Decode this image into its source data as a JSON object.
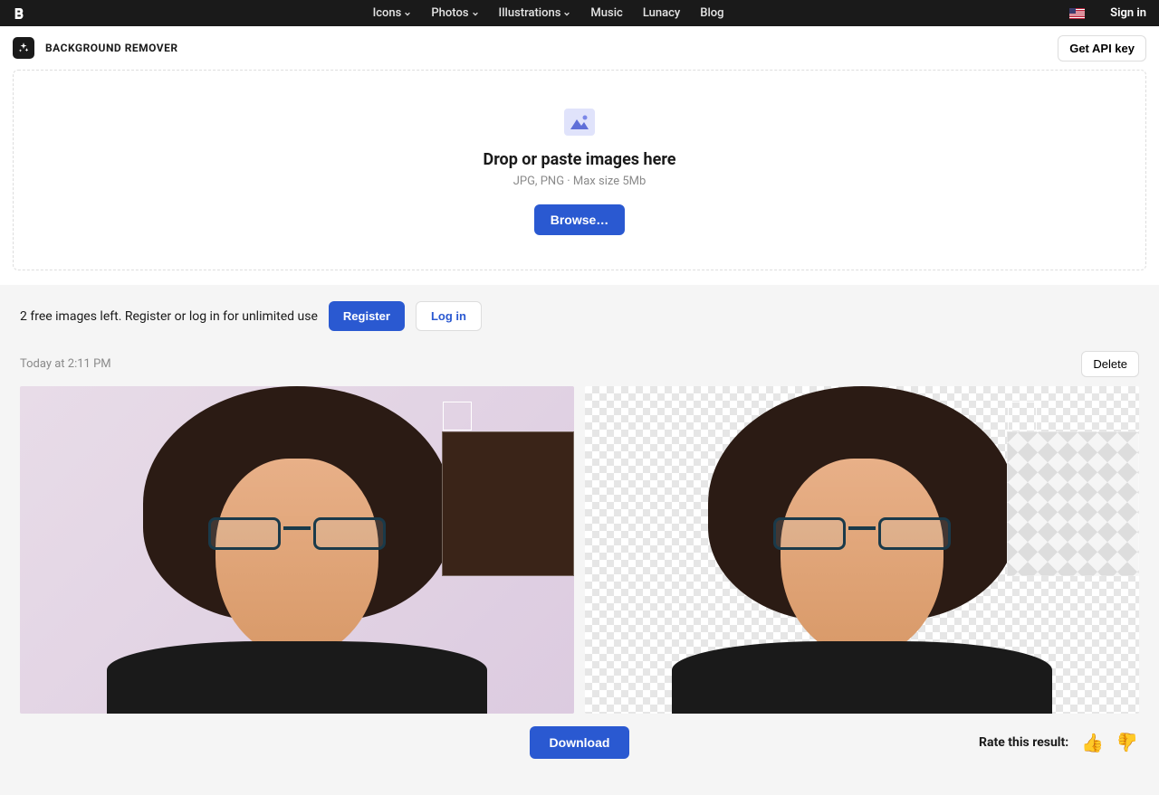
{
  "nav": {
    "items": [
      "Icons",
      "Photos",
      "Illustrations",
      "Music",
      "Lunacy",
      "Blog"
    ],
    "signin": "Sign in"
  },
  "subheader": {
    "title": "BACKGROUND REMOVER",
    "api_button": "Get API key"
  },
  "dropzone": {
    "title": "Drop or paste images here",
    "subtitle": "JPG, PNG · Max size 5Mb",
    "browse": "Browse…"
  },
  "strip": {
    "text": "2 free images left. Register or log in for unlimited use",
    "register": "Register",
    "login": "Log in"
  },
  "result": {
    "timestamp": "Today at 2:11 PM",
    "delete": "Delete",
    "download": "Download",
    "rate_label": "Rate this result:"
  }
}
